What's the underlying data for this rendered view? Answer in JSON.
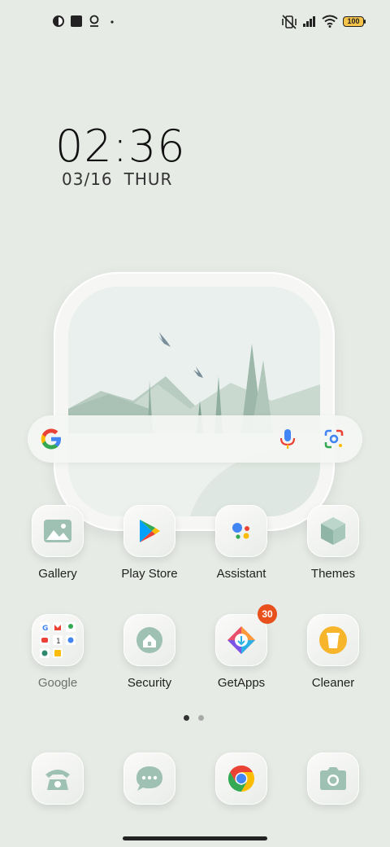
{
  "status_bar": {
    "battery_level": "100",
    "left_icons": [
      "circle-half-icon",
      "square-icon",
      "location-pin-icon",
      "dot-icon"
    ],
    "right_icons": [
      "vibrate-mute-icon",
      "signal-icon",
      "wifi-icon",
      "battery-icon"
    ]
  },
  "clock": {
    "time": "02:36",
    "date": "03/16",
    "weekday": "THUR"
  },
  "widget": {
    "scene": "landscape-window-icon"
  },
  "search": {
    "logo": "google-g-icon",
    "mic": "mic-icon",
    "lens": "google-lens-icon"
  },
  "apps_row1": [
    {
      "label": "Gallery",
      "icon": "gallery-icon"
    },
    {
      "label": "Play Store",
      "icon": "play-store-icon"
    },
    {
      "label": "Assistant",
      "icon": "assistant-icon"
    },
    {
      "label": "Themes",
      "icon": "themes-icon"
    }
  ],
  "apps_row2": [
    {
      "label": "Google",
      "icon": "folder-icon"
    },
    {
      "label": "Security",
      "icon": "security-icon"
    },
    {
      "label": "GetApps",
      "icon": "getapps-icon",
      "badge": "30"
    },
    {
      "label": "Cleaner",
      "icon": "cleaner-icon"
    }
  ],
  "dock": [
    {
      "icon": "phone-icon"
    },
    {
      "icon": "messages-icon"
    },
    {
      "icon": "chrome-icon"
    },
    {
      "icon": "camera-icon"
    }
  ],
  "pager": {
    "pages": 2,
    "current": 1
  },
  "colors": {
    "background": "#e7ebe6",
    "accent_green": "#8fb5a6",
    "badge": "#e8511c"
  }
}
